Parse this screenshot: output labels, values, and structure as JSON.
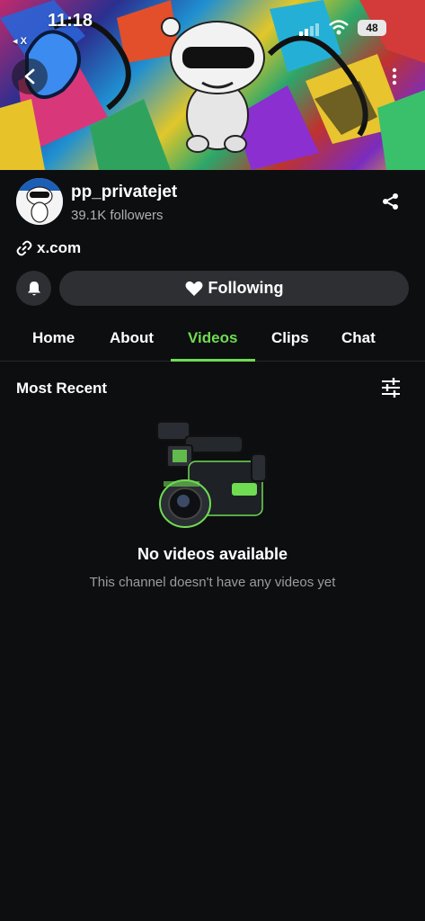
{
  "status_bar": {
    "time": "11:18",
    "back_app": "◂ X",
    "battery": "48"
  },
  "channel": {
    "name": "pp_privatejet",
    "followers": "39.1K followers",
    "link": "x.com"
  },
  "actions": {
    "following_label": "Following"
  },
  "tabs": [
    {
      "label": "Home",
      "active": false
    },
    {
      "label": "About",
      "active": false
    },
    {
      "label": "Videos",
      "active": true
    },
    {
      "label": "Clips",
      "active": false
    },
    {
      "label": "Chat",
      "active": false
    }
  ],
  "section": {
    "title": "Most Recent"
  },
  "empty_state": {
    "title": "No videos available",
    "subtitle": "This channel doesn't have any videos yet"
  },
  "colors": {
    "accent": "#6fdc52",
    "background": "#0d0e10",
    "button": "#2d2f33"
  },
  "icons": [
    "back-arrow-icon",
    "more-vertical-icon",
    "share-icon",
    "link-icon",
    "bell-icon",
    "heart-icon",
    "filter-sliders-icon",
    "video-camera-illustration"
  ]
}
